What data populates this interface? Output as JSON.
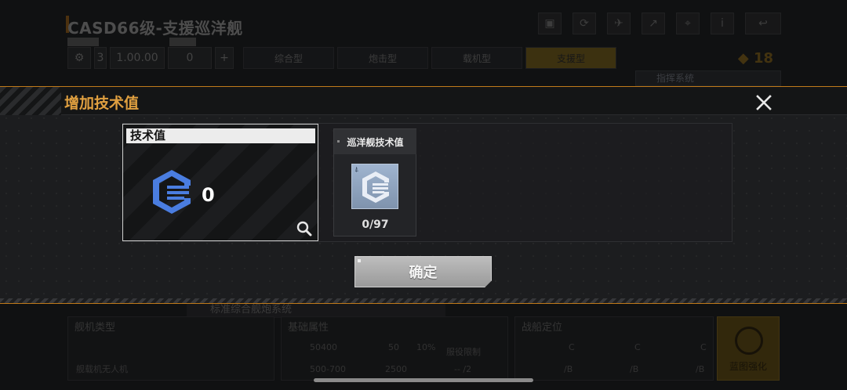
{
  "background": {
    "title": "CASD66级-支援巡洋舰",
    "stat_level": "3",
    "stat_value": "1.00.00",
    "stat_count": "0",
    "tabs": [
      {
        "label": "综合型",
        "active": false
      },
      {
        "label": "炮击型",
        "active": false
      },
      {
        "label": "载机型",
        "active": false
      },
      {
        "label": "支援型",
        "active": true
      }
    ],
    "coins": "18",
    "side_label": "指挥系统",
    "banner": "标准综合舰炮系统",
    "panel_titles": [
      "舰机类型",
      "基础属性",
      "战船定位"
    ],
    "aircraft_label": "舰载机无人机",
    "stats": [
      "50400",
      "50",
      "10%",
      "500-700",
      "2500"
    ],
    "deploy_label": "服役限制",
    "deploy_value": "-- /2",
    "strengthen_label": "蓝图强化",
    "grades": [
      "C",
      "C",
      "C",
      "/B",
      "/B",
      "/B"
    ]
  },
  "modal": {
    "title": "增加技术值",
    "tech_card": {
      "label": "技术值",
      "value": "0"
    },
    "item": {
      "name": "巡洋舰技术值",
      "count": "0/97"
    },
    "confirm_label": "确定"
  },
  "colors": {
    "accent_orange": "#c07a1a",
    "title_orange": "#e0a040",
    "icon_blue": "#4a7de0"
  }
}
